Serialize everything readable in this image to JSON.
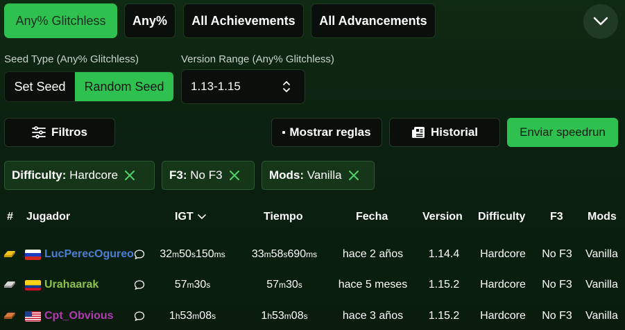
{
  "categories": [
    "Any% Glitchless",
    "Any%",
    "All Achievements",
    "All Advancements"
  ],
  "seed_type": {
    "label": "Seed Type (Any% Glitchless)",
    "options": [
      "Set Seed",
      "Random Seed"
    ],
    "selected": "Random Seed"
  },
  "version_range": {
    "label": "Version Range (Any% Glitchless)",
    "value": "1.13-1.15"
  },
  "actions": {
    "filters": "Filtros",
    "rules": "Mostrar reglas",
    "history": "Historial",
    "submit": "Enviar speedrun"
  },
  "chips": [
    {
      "key": "Difficulty:",
      "value": "Hardcore"
    },
    {
      "key": "F3:",
      "value": "No F3"
    },
    {
      "key": "Mods:",
      "value": "Vanilla"
    }
  ],
  "table": {
    "headers": {
      "rank": "#",
      "player": "Jugador",
      "igt": "IGT",
      "time": "Tiempo",
      "date": "Fecha",
      "version": "Version",
      "difficulty": "Difficulty",
      "f3": "F3",
      "mods": "Mods"
    },
    "rows": [
      {
        "medal": "gold-medal",
        "flag": "russia-flag",
        "player": "LucPerecOgureo",
        "player_color": "#4a7fd6",
        "igt": [
          [
            "32",
            "m"
          ],
          [
            " 50",
            "s"
          ],
          [
            " 150",
            "ms"
          ]
        ],
        "time": [
          [
            "33",
            "m"
          ],
          [
            " 58",
            "s"
          ],
          [
            " 690",
            "ms"
          ]
        ],
        "date": "hace 2 años",
        "version": "1.14.4",
        "difficulty": "Hardcore",
        "f3": "No F3",
        "mods": "Vanilla"
      },
      {
        "medal": "silver-medal",
        "flag": "colombia-flag",
        "player": "Urahaarak",
        "player_color": "#8bc34a",
        "igt": [
          [
            "57",
            "m"
          ],
          [
            " 30",
            "s"
          ]
        ],
        "time": [
          [
            "57",
            "m"
          ],
          [
            " 30",
            "s"
          ]
        ],
        "date": "hace 5 meses",
        "version": "1.15.2",
        "difficulty": "Hardcore",
        "f3": "No F3",
        "mods": "Vanilla"
      },
      {
        "medal": "bronze-medal",
        "flag": "usa-flag",
        "player": "Cpt_Obvious",
        "player_color": "#b23bb3",
        "igt": [
          [
            "1",
            "h"
          ],
          [
            " 53",
            "m"
          ],
          [
            " 08",
            "s"
          ]
        ],
        "time": [
          [
            "1",
            "h"
          ],
          [
            " 53",
            "m"
          ],
          [
            " 08",
            "s"
          ]
        ],
        "date": "hace 3 años",
        "version": "1.15.2",
        "difficulty": "Hardcore",
        "f3": "No F3",
        "mods": "Vanilla"
      }
    ]
  },
  "colors": {
    "accent": "#2ec14f",
    "background": "#0f2a12",
    "button_dark": "#0a0f0b",
    "chip_bg": "#163619",
    "chip_x": "#4fd36a"
  }
}
